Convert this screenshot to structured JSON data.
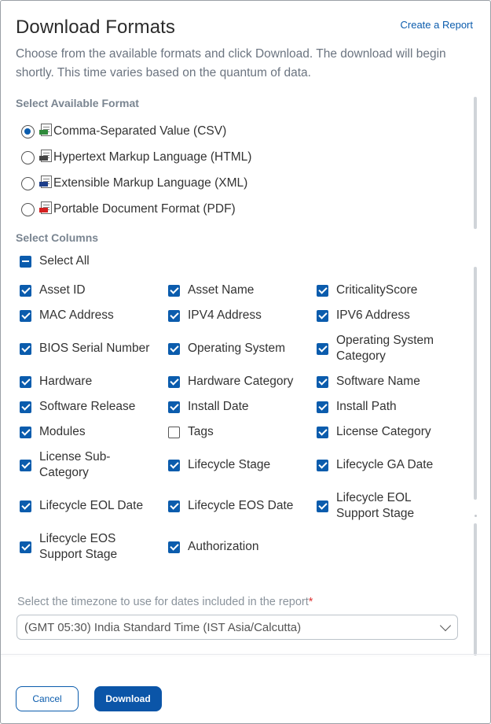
{
  "header": {
    "title": "Download Formats",
    "create_report_link": "Create a Report",
    "description": "Choose from the available formats and click Download. The download will begin shortly. This time varies based on the quantum of data."
  },
  "formats": {
    "label": "Select Available Format",
    "selected": "Comma-Separated Value (CSV)",
    "options": [
      {
        "label": "Comma-Separated Value (CSV)",
        "icon": "csv-file-icon"
      },
      {
        "label": "Hypertext Markup Language (HTML)",
        "icon": "html-file-icon"
      },
      {
        "label": "Extensible Markup Language (XML)",
        "icon": "xml-file-icon"
      },
      {
        "label": "Portable Document Format (PDF)",
        "icon": "pdf-file-icon"
      }
    ]
  },
  "columns": {
    "label": "Select Columns",
    "select_all_label": "Select All",
    "select_all_state": "indeterminate",
    "items": [
      {
        "label": "Asset ID",
        "checked": true
      },
      {
        "label": "Asset Name",
        "checked": true
      },
      {
        "label": "CriticalityScore",
        "checked": true
      },
      {
        "label": "MAC Address",
        "checked": true
      },
      {
        "label": "IPV4 Address",
        "checked": true
      },
      {
        "label": "IPV6 Address",
        "checked": true
      },
      {
        "label": "BIOS Serial Number",
        "checked": true
      },
      {
        "label": "Operating System",
        "checked": true
      },
      {
        "label": "Operating System Category",
        "checked": true
      },
      {
        "label": "Hardware",
        "checked": true
      },
      {
        "label": "Hardware Category",
        "checked": true
      },
      {
        "label": "Software Name",
        "checked": true
      },
      {
        "label": "Software Release",
        "checked": true
      },
      {
        "label": "Install Date",
        "checked": true
      },
      {
        "label": "Install Path",
        "checked": true
      },
      {
        "label": "Modules",
        "checked": true
      },
      {
        "label": "Tags",
        "checked": false
      },
      {
        "label": "License Category",
        "checked": true
      },
      {
        "label": "License Sub-Category",
        "checked": true
      },
      {
        "label": "Lifecycle Stage",
        "checked": true
      },
      {
        "label": "Lifecycle GA Date",
        "checked": true
      },
      {
        "label": "Lifecycle EOL Date",
        "checked": true
      },
      {
        "label": "Lifecycle EOS Date",
        "checked": true
      },
      {
        "label": "Lifecycle EOL Support Stage",
        "checked": true
      },
      {
        "label": "Lifecycle EOS Support Stage",
        "checked": true
      },
      {
        "label": "Authorization",
        "checked": true
      }
    ]
  },
  "timezone": {
    "label": "Select the timezone to use for dates included in the report",
    "required_mark": "*",
    "value": "(GMT 05:30) India Standard Time (IST Asia/Calcutta)"
  },
  "footer": {
    "cancel_label": "Cancel",
    "download_label": "Download"
  },
  "colors": {
    "accent": "#0b5cad",
    "required": "#dd3333"
  }
}
